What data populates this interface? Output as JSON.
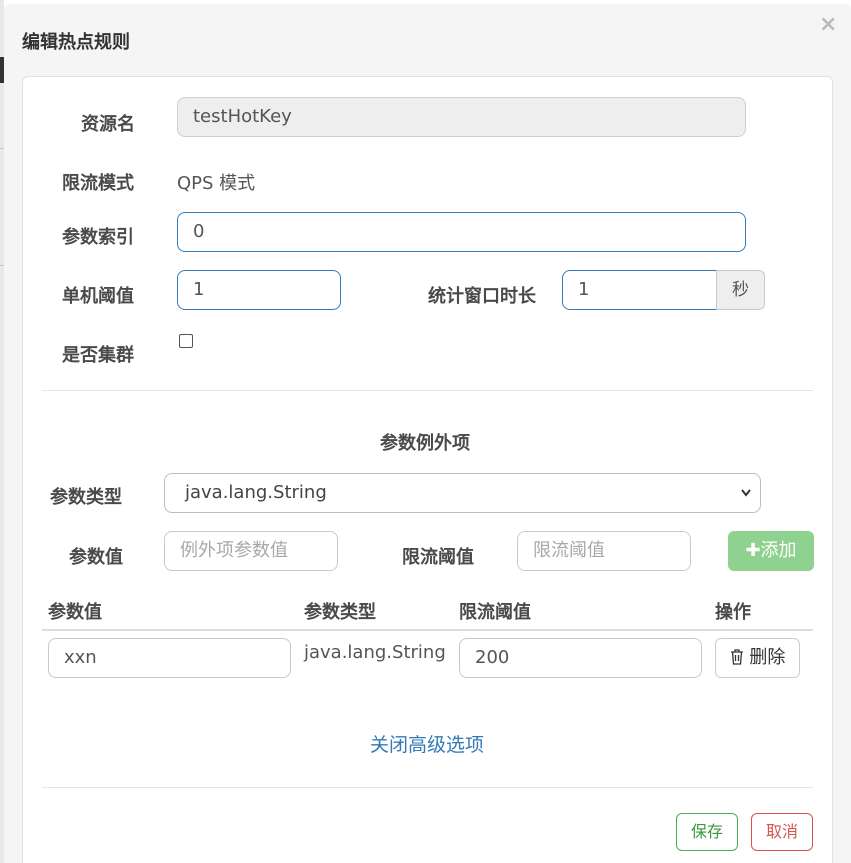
{
  "dialog": {
    "title": "编辑热点规则",
    "close_label": "×"
  },
  "form": {
    "resource_label": "资源名",
    "resource_value": "testHotKey",
    "mode_label": "限流模式",
    "mode_value": "QPS 模式",
    "param_index_label": "参数索引",
    "param_index_value": "0",
    "threshold_label": "单机阈值",
    "threshold_value": "1",
    "window_label": "统计窗口时长",
    "window_value": "1",
    "window_unit": "秒",
    "cluster_label": "是否集群",
    "cluster_checked": false
  },
  "exceptions": {
    "section_title": "参数例外项",
    "type_label": "参数类型",
    "type_selected": "java.lang.String",
    "value_label": "参数值",
    "value_placeholder": "例外项参数值",
    "limit_label": "限流阈值",
    "limit_placeholder": "限流阈值",
    "add_icon": "plus-icon",
    "add_label": "添加"
  },
  "table": {
    "columns": [
      "参数值",
      "参数类型",
      "限流阈值",
      "操作"
    ],
    "rows": [
      {
        "value": "xxn",
        "type": "java.lang.String",
        "limit": "200",
        "action_icon": "trash-icon",
        "action": "删除"
      }
    ]
  },
  "advanced_toggle": "关闭高级选项",
  "footer": {
    "save": "保存",
    "cancel": "取消"
  },
  "colors": {
    "link": "#337ab7",
    "success": "#4cae4c",
    "danger": "#d9534f",
    "add_button": "#8fd18f"
  }
}
